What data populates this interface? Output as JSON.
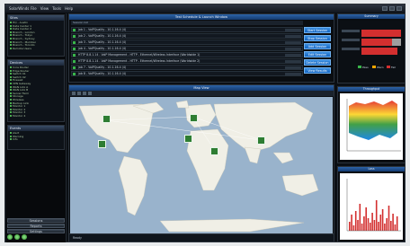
{
  "app": {
    "title": "SolarWinds",
    "menu": [
      "File",
      "View",
      "Tools",
      "Help"
    ]
  },
  "left": {
    "panel1_title": "Sites",
    "tree1": [
      "HQ - Austin",
      "Data Center 1",
      "Data Center 2",
      "Branch - London",
      "Branch - Tokyo",
      "Branch - Sydney",
      "Branch - Mumbai",
      "Branch - Toronto",
      "Remote Users"
    ],
    "panel2_title": "Devices",
    "tree2": [
      "Core Router",
      "Edge Router",
      "Switch 01",
      "Switch 02",
      "Firewall",
      "VPN Gateway",
      "WAN Link A",
      "WAN Link B",
      "Server Farm",
      "Storage",
      "Wireless",
      "Backup Link",
      "Monitor 1",
      "Monitor 2",
      "Monitor 3",
      "Monitor 4"
    ],
    "panel3_title": "Events",
    "tree3": [
      "Alert",
      "Warning",
      "Info"
    ],
    "nav_buttons": [
      "Sessions",
      "Reports",
      "Settings"
    ]
  },
  "sessions": {
    "header": "Test Schedule & Launch Window",
    "subheader": "Session list",
    "rows": [
      "job 1 - VoIPQuality - 10.1.16.4 (4)",
      "job 2 - VoIPQuality - 10.1.16.4 (4)",
      "job 3 - VoIPQuality - 10.1.16.4 (4)",
      "job 4 - VoIPQuality - 10.1.16.4 (4)",
      "HTTP 8.8.1.14 - VoIP Management - HTTP - Ethernet/Wireless Interface (Worldwide 1)",
      "HTTP 8.8.1.14 - VoIP Management - HTTP - Ethernet/Wireless Interface (Worldwide 2)",
      "job 7 - VoIPQuality - 10.1.16.4 (4)",
      "job 8 - VoIPQuality - 10.1.16.4 (4)"
    ],
    "actions": [
      "Start Session",
      "Stop Session",
      "Add Session",
      "Edit Session",
      "Delete Session",
      "View Results"
    ]
  },
  "map": {
    "header": "Map View",
    "footer": "Ready"
  },
  "right": {
    "panel1_title": "Summary",
    "panel2_title": "Throughput",
    "panel3_title": "Loss",
    "legend": [
      "Pass",
      "Warn",
      "Fail"
    ],
    "status_colors": {
      "pass": "#39b54a",
      "warn": "#f0a500",
      "fail": "#d32f2f"
    }
  }
}
